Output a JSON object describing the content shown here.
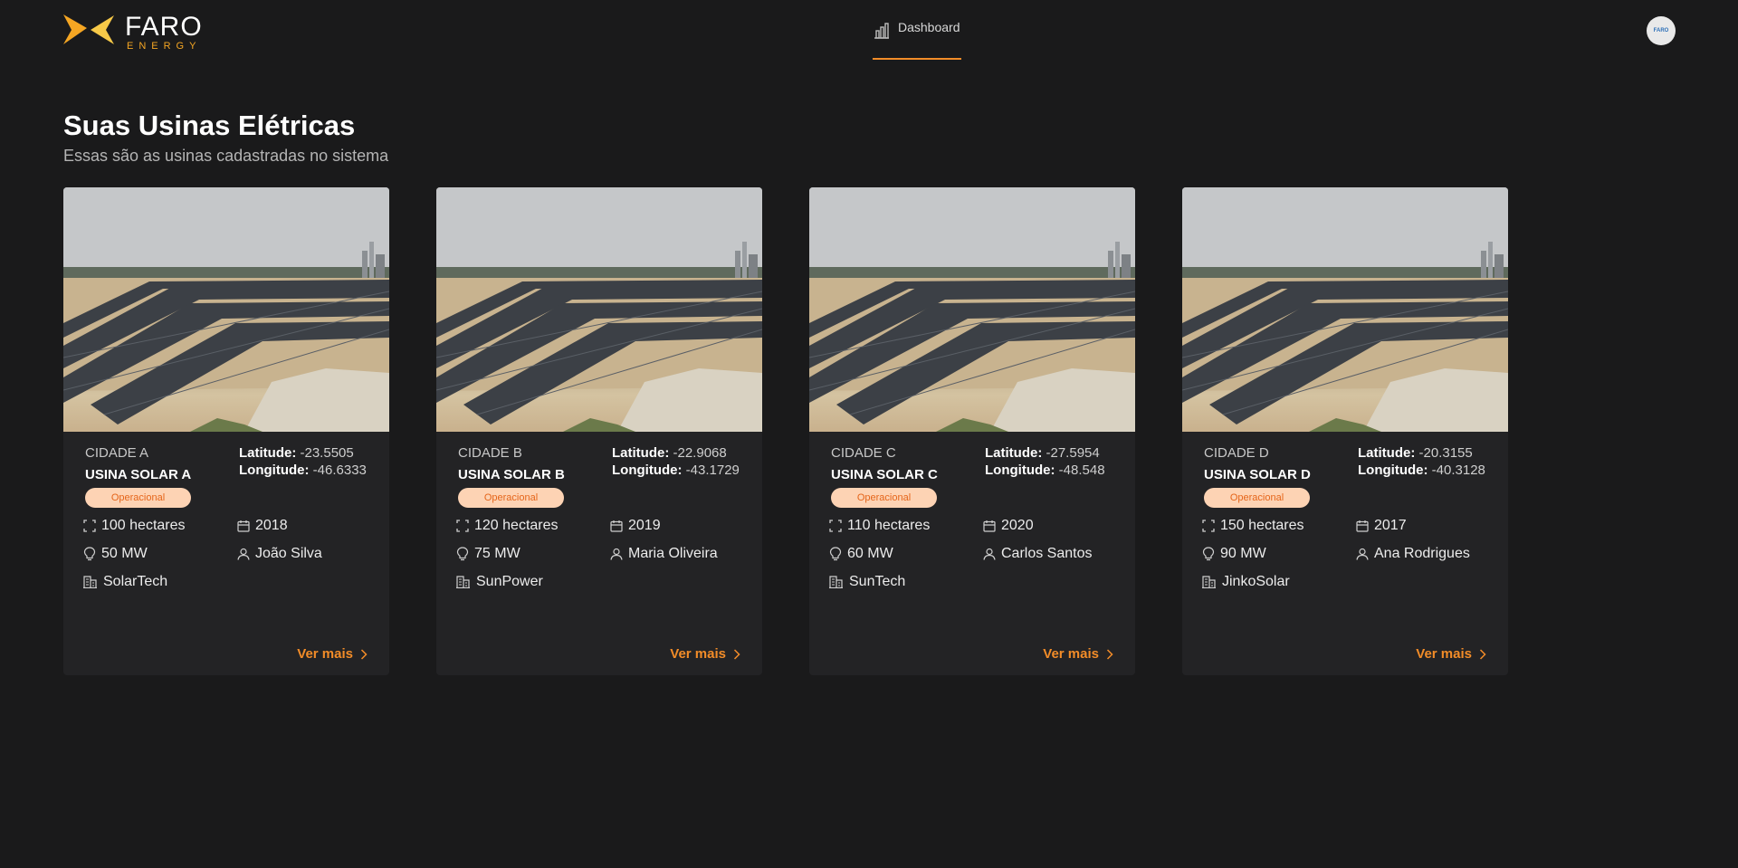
{
  "header": {
    "logo_word": "FARO",
    "logo_sub": "ENERGY",
    "nav_dashboard": "Dashboard",
    "avatar_text": "FARO"
  },
  "main": {
    "title": "Suas Usinas Elétricas",
    "subtitle": "Essas são as usinas cadastradas no sistema"
  },
  "labels": {
    "latitude": "Latitude:",
    "longitude": "Longitude:",
    "more": "Ver mais"
  },
  "colors": {
    "accent": "#f28c28",
    "badge_bg": "#fdd3b4",
    "badge_text": "#e5651a",
    "background": "#1a1a1b",
    "card": "#232325"
  },
  "plants": [
    {
      "city": "CIDADE A",
      "name": "USINA SOLAR A",
      "status": "Operacional",
      "latitude": "-23.5505",
      "longitude": "-46.6333",
      "area": "100 hectares",
      "year": "2018",
      "power": "50 MW",
      "owner": "João Silva",
      "manufacturer": "SolarTech"
    },
    {
      "city": "CIDADE B",
      "name": "USINA SOLAR B",
      "status": "Operacional",
      "latitude": "-22.9068",
      "longitude": "-43.1729",
      "area": "120 hectares",
      "year": "2019",
      "power": "75 MW",
      "owner": "Maria Oliveira",
      "manufacturer": "SunPower"
    },
    {
      "city": "CIDADE C",
      "name": "USINA SOLAR C",
      "status": "Operacional",
      "latitude": "-27.5954",
      "longitude": "-48.548",
      "area": "110 hectares",
      "year": "2020",
      "power": "60 MW",
      "owner": "Carlos Santos",
      "manufacturer": "SunTech"
    },
    {
      "city": "CIDADE D",
      "name": "USINA SOLAR D",
      "status": "Operacional",
      "latitude": "-20.3155",
      "longitude": "-40.3128",
      "area": "150 hectares",
      "year": "2017",
      "power": "90 MW",
      "owner": "Ana Rodrigues",
      "manufacturer": "JinkoSolar"
    }
  ]
}
